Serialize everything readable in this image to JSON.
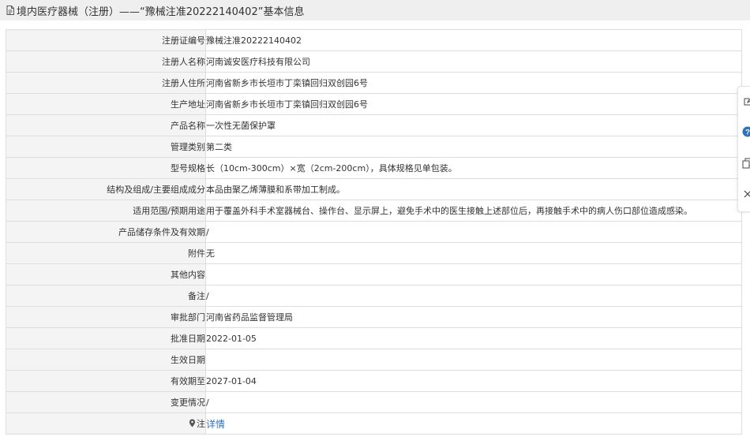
{
  "header": {
    "title": "境内医疗器械（注册）——“豫械注准20222140402”基本信息",
    "icon": "document-icon"
  },
  "rows": [
    {
      "label": "注册证编号",
      "value": "豫械注准20222140402"
    },
    {
      "label": "注册人名称",
      "value": "河南诚安医疗科技有限公司"
    },
    {
      "label": "注册人住所",
      "value": "河南省新乡市长垣市丁栾镇回归双创园6号"
    },
    {
      "label": "生产地址",
      "value": "河南省新乡市长垣市丁栾镇回归双创园6号"
    },
    {
      "label": "产品名称",
      "value": "一次性无菌保护罩"
    },
    {
      "label": "管理类别",
      "value": "第二类"
    },
    {
      "label": "型号规格",
      "value": "长（10cm-300cm）×宽（2cm-200cm），具体规格见单包装。"
    },
    {
      "label": "结构及组成/主要组成成分",
      "value": "本品由聚乙烯薄膜和系带加工制成。"
    },
    {
      "label": "适用范围/预期用途",
      "value": "用于覆盖外科手术室器械台、操作台、显示屏上，避免手术中的医生接触上述部位后，再接触手术中的病人伤口部位造成感染。"
    },
    {
      "label": "产品储存条件及有效期",
      "value": "/"
    },
    {
      "label": "附件",
      "value": "无"
    },
    {
      "label": "其他内容",
      "value": ""
    },
    {
      "label": "备注",
      "value": "/"
    },
    {
      "label": "审批部门",
      "value": "河南省药品监督管理局"
    },
    {
      "label": "批准日期",
      "value": "2022-01-05"
    },
    {
      "label": "生效日期",
      "value": ""
    },
    {
      "label": "有效期至",
      "value": "2027-01-04"
    },
    {
      "label": "变更情况",
      "value": "/"
    }
  ],
  "note_row": {
    "label": "注",
    "link_text": "详情",
    "icon": "pin-icon"
  },
  "toolbar": {
    "icons": [
      "edit-icon",
      "help-icon",
      "copy-icon",
      "close-icon"
    ],
    "help_color": "#2f72b9"
  },
  "colors": {
    "header_bg": "#efefef",
    "label_bg": "#f4f4f4",
    "border": "#dedede",
    "link": "#2f72b9"
  }
}
